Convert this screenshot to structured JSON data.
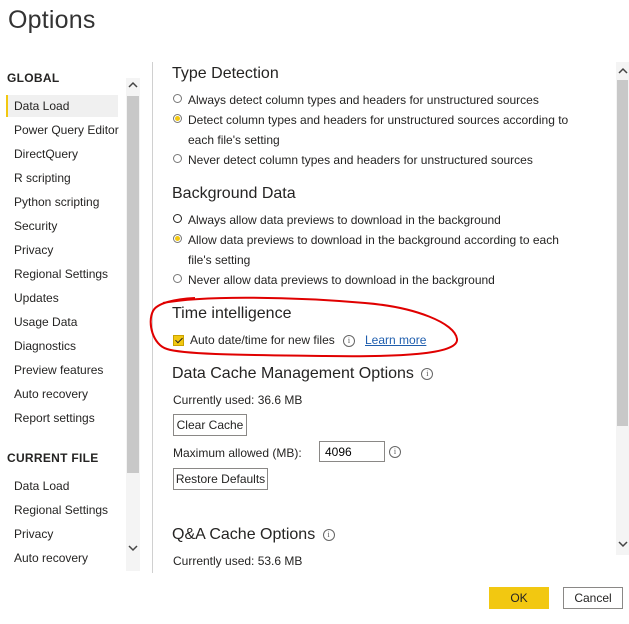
{
  "window": {
    "title": "Options"
  },
  "sidebar": {
    "global_header": "GLOBAL",
    "global_items": [
      {
        "label": "Data Load",
        "selected": true
      },
      {
        "label": "Power Query Editor"
      },
      {
        "label": "DirectQuery"
      },
      {
        "label": "R scripting"
      },
      {
        "label": "Python scripting"
      },
      {
        "label": "Security"
      },
      {
        "label": "Privacy"
      },
      {
        "label": "Regional Settings"
      },
      {
        "label": "Updates"
      },
      {
        "label": "Usage Data"
      },
      {
        "label": "Diagnostics"
      },
      {
        "label": "Preview features"
      },
      {
        "label": "Auto recovery"
      },
      {
        "label": "Report settings"
      }
    ],
    "current_file_header": "CURRENT FILE",
    "current_file_items": [
      {
        "label": "Data Load"
      },
      {
        "label": "Regional Settings"
      },
      {
        "label": "Privacy"
      },
      {
        "label": "Auto recovery"
      }
    ]
  },
  "type_detection": {
    "heading": "Type Detection",
    "options": [
      {
        "label": "Always detect column types and headers for unstructured sources",
        "checked": false
      },
      {
        "label": "Detect column types and headers for unstructured sources according to each file's setting",
        "checked": true
      },
      {
        "label": "Never detect column types and headers for unstructured sources",
        "checked": false
      }
    ]
  },
  "background_data": {
    "heading": "Background Data",
    "options": [
      {
        "label": "Always allow data previews to download in the background",
        "checked": false
      },
      {
        "label": "Allow data previews to download in the background according to each file's setting",
        "checked": true
      },
      {
        "label": "Never allow data previews to download in the background",
        "checked": false
      }
    ]
  },
  "time_intelligence": {
    "heading": "Time intelligence",
    "checkbox_label": "Auto date/time for new files",
    "checked": true,
    "learn_more": "Learn more"
  },
  "data_cache": {
    "heading": "Data Cache Management Options",
    "currently_used": "Currently used: 36.6 MB",
    "clear_cache": "Clear Cache",
    "max_allowed_label": "Maximum allowed (MB):",
    "max_allowed_value": "4096",
    "restore_defaults": "Restore Defaults"
  },
  "qa_cache": {
    "heading": "Q&A Cache Options",
    "currently_used": "Currently used: 53.6 MB"
  },
  "footer": {
    "ok": "OK",
    "cancel": "Cancel"
  },
  "colors": {
    "accent": "#f2c811",
    "annotation": "#e00000",
    "link": "#1f5eae"
  },
  "icons": {
    "info": "info-icon",
    "scroll_up": "chevron-up-icon",
    "scroll_down": "chevron-down-icon"
  }
}
